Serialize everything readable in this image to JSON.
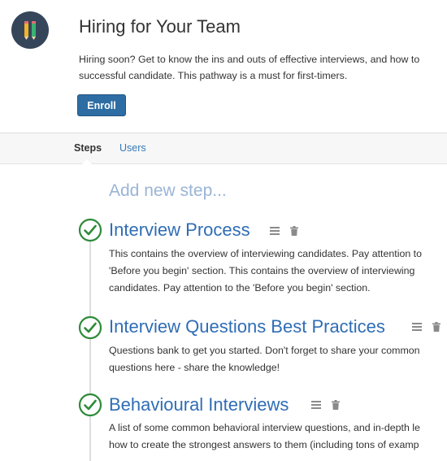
{
  "header": {
    "title": "Hiring for Your Team",
    "description_lines": [
      "Hiring soon? Get to know the ins and outs of effective interviews, and how to",
      "successful candidate. This pathway is a must for first-timers."
    ],
    "enroll_label": "Enroll",
    "logo_icon": "pencils-logo-icon"
  },
  "tabs": [
    {
      "label": "Steps",
      "active": true
    },
    {
      "label": "Users",
      "active": false
    }
  ],
  "add_step_label": "Add new step...",
  "steps": [
    {
      "title": "Interview Process",
      "completed": true,
      "description_lines": [
        "This contains the overview of interviewing candidates. Pay attention to",
        "'Before you begin' section. This contains the overview of interviewing",
        "candidates. Pay attention to the 'Before you begin' section."
      ]
    },
    {
      "title": "Interview Questions Best Practices",
      "completed": true,
      "description_lines": [
        "Questions bank to get you started. Don't forget to share your common",
        "questions here - share the knowledge!"
      ]
    },
    {
      "title": "Behavioural Interviews",
      "completed": true,
      "description_lines": [
        "A list of some common behavioral interview questions, and in-depth le",
        "how to create the strongest answers to them (including tons of examp"
      ]
    }
  ],
  "colors": {
    "accent": "#2e6da4",
    "link": "#337ab7",
    "step_title": "#2f6db5",
    "check_green": "#2e8b3a",
    "add_step": "#9ab4d6",
    "logo_bg": "#36465a"
  }
}
